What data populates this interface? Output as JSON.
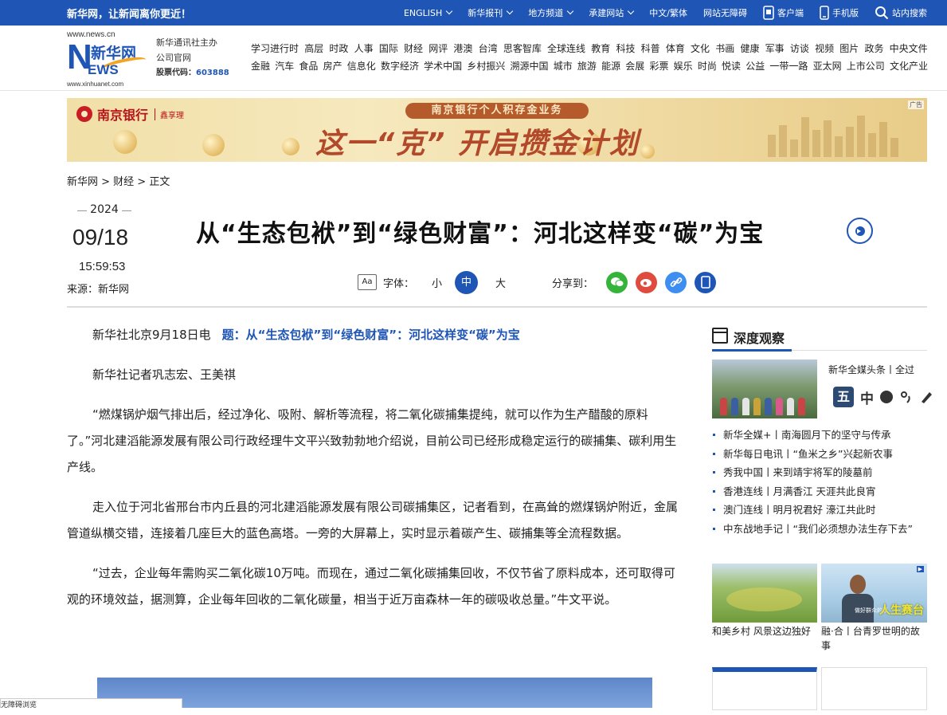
{
  "topbar": {
    "slogan": "新华网，让新闻离你更近！",
    "items": [
      {
        "label": "ENGLISH",
        "dropdown": true
      },
      {
        "label": "新华报刊",
        "dropdown": true
      },
      {
        "label": "地方频道",
        "dropdown": true
      },
      {
        "label": "承建网站",
        "dropdown": true
      },
      {
        "label": "中文/繁体",
        "dropdown": false
      },
      {
        "label": "网站无障碍",
        "dropdown": false
      }
    ],
    "client": "客户端",
    "mobile": "手机版",
    "search": "站内搜索"
  },
  "header": {
    "logo": {
      "url_top": "www.news.cn",
      "brand_big": "N",
      "brand_cn": "新华网",
      "brand_ews": "EWS",
      "url_bottom": "www.xinhuanet.com"
    },
    "org_line1": "新华通讯社主办",
    "org_line2": "公司官网",
    "stock_label": "股票代码：",
    "stock_code": "603888",
    "nav_row1": [
      "学习进行时",
      "高层",
      "时政",
      "人事",
      "国际",
      "财经",
      "网评",
      "港澳",
      "台湾",
      "思客智库",
      "全球连线",
      "教育",
      "科技",
      "科普",
      "体育",
      "文化",
      "书画",
      "健康",
      "军事",
      "访谈",
      "视频",
      "图片",
      "政务",
      "中央文件"
    ],
    "nav_row2": [
      "金融",
      "汽车",
      "食品",
      "房产",
      "信息化",
      "数字经济",
      "学术中国",
      "乡村振兴",
      "溯源中国",
      "城市",
      "旅游",
      "能源",
      "会展",
      "彩票",
      "娱乐",
      "时尚",
      "悦读",
      "公益",
      "一带一路",
      "亚太网",
      "上市公司",
      "文化产业"
    ]
  },
  "ad": {
    "bank": "南京银行",
    "bank_sub": "鑫享理",
    "pill": "南京银行个人积存金业务",
    "slogan": "这一“克”  开启攒金计划",
    "tag": "广告"
  },
  "breadcrumb": "新华网 > 财经 > 正文",
  "meta": {
    "year": "2024",
    "month_day": "09/18",
    "time": "15:59:53",
    "source": "来源：新华网"
  },
  "headline": "从“生态包袱”到“绿色财富”：河北这样变“碳”为宝",
  "toolbar": {
    "font_icon": "Aa",
    "font_label": "字体：",
    "small": "小",
    "medium": "中",
    "large": "大",
    "share_label": "分享到：",
    "share_icons": [
      {
        "name": "wechat-icon",
        "color": "#36b33b",
        "glyph": "●"
      },
      {
        "name": "weibo-icon",
        "color": "#e04b3f",
        "glyph": "◉"
      },
      {
        "name": "link-icon",
        "color": "#3d8ef0",
        "glyph": "∞"
      },
      {
        "name": "mobile-icon",
        "color": "#1f56b5",
        "glyph": "▯"
      }
    ]
  },
  "article": {
    "lead_prefix": "新华社北京9月18日电",
    "lead_title": "题：从“生态包袱”到“绿色财富”：河北这样变“碳”为宝",
    "byline": "新华社记者巩志宏、王美祺",
    "paragraphs": [
      "“燃煤锅炉烟气排出后，经过净化、吸附、解析等流程，将二氧化碳捕集提纯，就可以作为生产醋酸的原料了。”河北建滔能源发展有限公司行政经理牛文平兴致勃勃地介绍说，目前公司已经形成稳定运行的碳捕集、碳利用生产线。",
      "走入位于河北省邢台市内丘县的河北建滔能源发展有限公司碳捕集区，记者看到，在高耸的燃煤锅炉附近，金属管道纵横交错，连接着几座巨大的蓝色高塔。一旁的大屏幕上，实时显示着碳产生、碳捕集等全流程数据。",
      "“过去，企业每年需购买二氧化碳10万吨。而现在，通过二氧化碳捕集回收，不仅节省了原料成本，还可取得可观的环境效益，据测算，企业每年回收的二氧化碳量，相当于近万亩森林一年的碳吸收总量。”牛文平说。"
    ],
    "floatbar": "无障碍浏览"
  },
  "sidebar": {
    "title": "深度观察",
    "feature_caption": "新华全媒头条丨全过",
    "reader": {
      "wu": "五",
      "zh": "中"
    },
    "list": [
      "新华全媒+丨南海圆月下的坚守与传承",
      "新华每日电讯丨“鱼米之乡”兴起新农事",
      "秀我中国丨来到靖宇将军的陵墓前",
      "香港连线丨月满香江 天涯共此良宵",
      "澳门连线丨明月祝君好 濠江共此时",
      "中东战地手记丨“我们必须想办法生存下去”"
    ],
    "img3_label": "人生赛台",
    "img3_small": "做好群众的事",
    "caption2": "和美乡村 风景这边独好",
    "caption3": "融·合丨台青罗世明的故事"
  }
}
